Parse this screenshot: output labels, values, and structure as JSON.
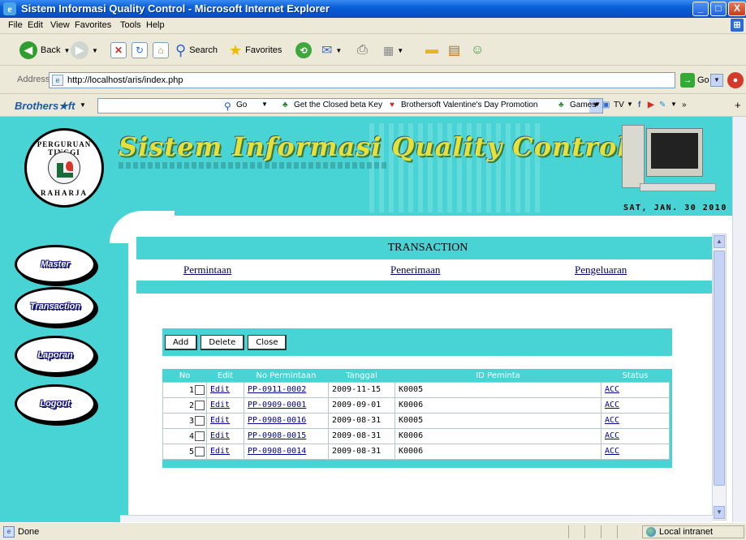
{
  "window": {
    "title": "Sistem Informasi Quality Control - Microsoft Internet Explorer",
    "minimize": "_",
    "maximize": "□",
    "close": "X"
  },
  "menu": [
    "File",
    "Edit",
    "View",
    "Favorites",
    "Tools",
    "Help"
  ],
  "toolbar": {
    "back_label": "Back",
    "search_label": "Search",
    "favorites_label": "Favorites"
  },
  "address": {
    "label": "Address",
    "url": "http://localhost/aris/index.php",
    "go_label": "Go"
  },
  "brothersoft": {
    "logo": "Brothers★ft",
    "go_label": "Go",
    "items": [
      "Get the Closed beta Key",
      "Brothersoft Valentine's Day Promotion",
      "Games",
      "TV"
    ]
  },
  "banner": {
    "title": "Sistem Informasi Quality Control",
    "emblem_top": "PERGURUAN TINGGI",
    "emblem_bottom": "RAHARJA",
    "date": "SAT, JAN. 30 2010"
  },
  "nav": [
    "Master",
    "Transaction",
    "Laporan",
    "Logout"
  ],
  "transaction": {
    "heading": "TRANSACTION",
    "links": [
      "Permintaan",
      "Penerimaan",
      "Pengeluaran"
    ]
  },
  "grid": {
    "buttons": [
      "Add",
      "Delete",
      "Close"
    ],
    "columns": [
      "No",
      "Edit",
      "No Permintaan",
      "Tanggal",
      "ID Peminta",
      "Status"
    ],
    "rows": [
      {
        "no": "1",
        "edit": "Edit",
        "no_permintaan": "PP-0911-0002",
        "tanggal": "2009-11-15",
        "id_peminta": "K0005",
        "status": "ACC"
      },
      {
        "no": "2",
        "edit": "Edit",
        "no_permintaan": "PP-0909-0001",
        "tanggal": "2009-09-01",
        "id_peminta": "K0006",
        "status": "ACC"
      },
      {
        "no": "3",
        "edit": "Edit",
        "no_permintaan": "PP-0908-0016",
        "tanggal": "2009-08-31",
        "id_peminta": "K0005",
        "status": "ACC"
      },
      {
        "no": "4",
        "edit": "Edit",
        "no_permintaan": "PP-0908-0015",
        "tanggal": "2009-08-31",
        "id_peminta": "K0006",
        "status": "ACC"
      },
      {
        "no": "5",
        "edit": "Edit",
        "no_permintaan": "PP-0908-0014",
        "tanggal": "2009-08-31",
        "id_peminta": "K0006",
        "status": "ACC"
      }
    ]
  },
  "status": {
    "text": "Done",
    "zone": "Local intranet"
  },
  "colors": {
    "teal": "#48d4d4",
    "xp_blue": "#0a5fd8",
    "chrome": "#ece9d8"
  }
}
